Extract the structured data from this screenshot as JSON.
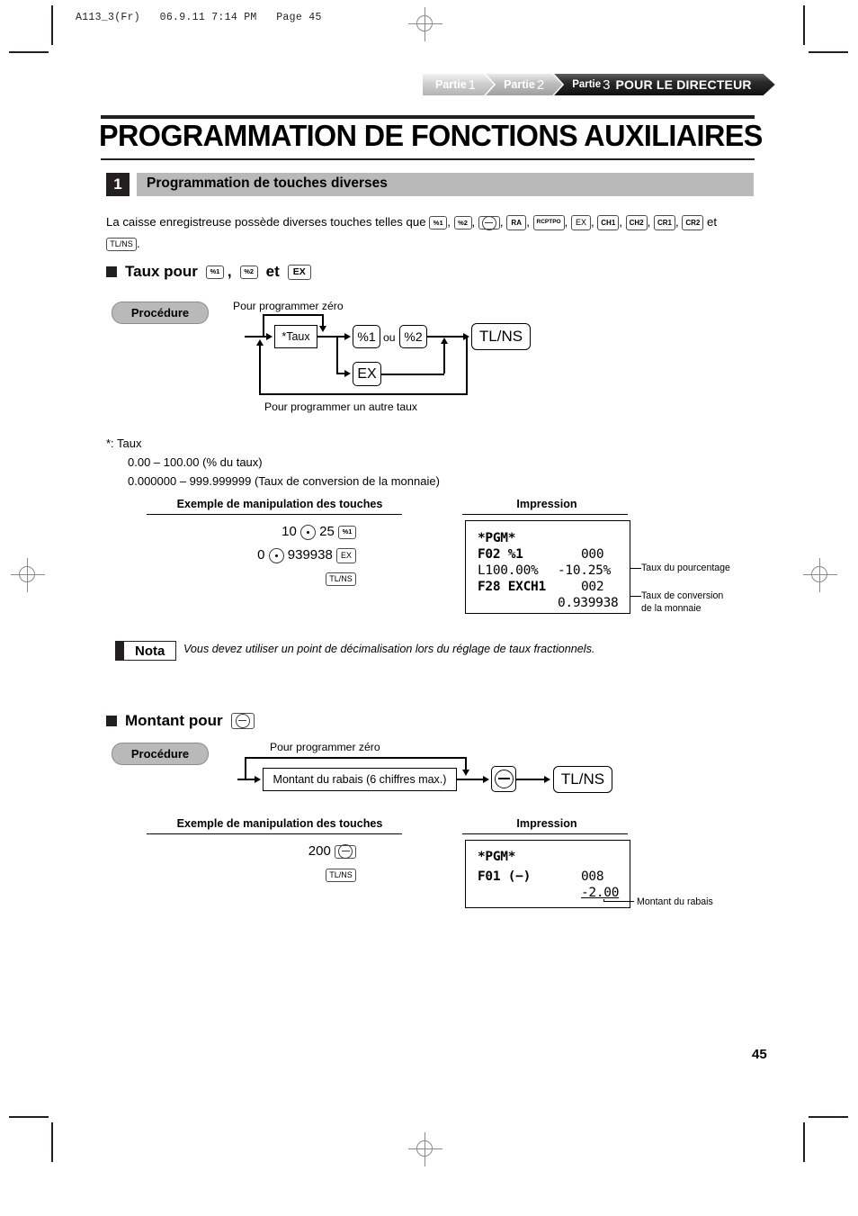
{
  "print_slug": "A113_3(Fr)   06.9.11 7:14 PM   Page 45",
  "tabs": {
    "part1_label": "Partie",
    "part1_num": "1",
    "part2_label": "Partie",
    "part2_num": "2",
    "part3_label": "Partie",
    "part3_num": "3",
    "part3_title": "POUR LE DIRECTEUR"
  },
  "chapter_title": "PROGRAMMATION DE FONCTIONS AUXILIAIRES",
  "section": {
    "number": "1",
    "title": "Programmation de touches diverses"
  },
  "intro": {
    "text_before": "La caisse enregistreuse possède diverses touches telles que",
    "keys": [
      "%1",
      "%2",
      "⊖",
      "RA",
      "RCPTPO",
      "EX",
      "CH1",
      "CH2",
      "CR1",
      "CR2"
    ],
    "text_and": "et",
    "last_key": "TL/NS",
    "period": "."
  },
  "rate_section": {
    "heading_text": "Taux pour",
    "heading_key1": "%1",
    "heading_comma": ",",
    "heading_key2": "%2",
    "heading_et": "et",
    "heading_key3": "EX",
    "procedure_label": "Procédure",
    "flow": {
      "top_label": "Pour programmer zéro",
      "bottom_label": "Pour programmer un autre taux",
      "entry_box": "*Taux",
      "key_pct1": "%1",
      "or_label": "ou",
      "key_pct2": "%2",
      "key_ex": "EX",
      "key_tlns": "TL/NS"
    },
    "footnote": {
      "line1": "*:  Taux",
      "line2": "0.00 – 100.00 (% du taux)",
      "line3": "0.000000 – 999.999999 (Taux de conversion de la monnaie)"
    },
    "example_head": "Exemple de manipulation des touches",
    "impression_head": "Impression",
    "keystrokes": [
      {
        "digits_a": "10",
        "dot": true,
        "digits_b": "25",
        "key": "%1"
      },
      {
        "digits_a": "0",
        "dot": true,
        "digits_b": "939938",
        "key": "EX"
      },
      {
        "digits_a": "",
        "dot": false,
        "digits_b": "",
        "key": "TL/NS"
      }
    ],
    "receipt_lines": [
      {
        "left": "*PGM*",
        "right": "",
        "bold": true
      },
      {
        "left": "F02 %1",
        "right": "000",
        "bold": false
      },
      {
        "left": "L100.00%",
        "right": "-10.25%",
        "bold": false
      },
      {
        "left": "F28 EXCH1",
        "right": "002",
        "bold": false
      },
      {
        "left": "",
        "right": "0.939938",
        "bold": false
      }
    ],
    "callout_1": "Taux du pourcentage",
    "callout_2": "Taux de conversion\nde la monnaie"
  },
  "nota": {
    "label": "Nota",
    "text": "Vous devez utiliser un point de décimalisation lors du réglage de taux fractionnels."
  },
  "amount_section": {
    "heading_text": "Montant pour",
    "heading_key": "⊖",
    "procedure_label": "Procédure",
    "flow": {
      "top_label": "Pour programmer zéro",
      "entry_box": "Montant du rabais (6 chiffres max.)",
      "key_minus": "⊖",
      "key_tlns": "TL/NS"
    },
    "example_head": "Exemple de manipulation des touches",
    "impression_head": "Impression",
    "keystrokes": [
      {
        "digits": "200",
        "key": "minus"
      },
      {
        "digits": "",
        "key": "TL/NS"
      }
    ],
    "receipt_lines": [
      {
        "left": "*PGM*",
        "right": "",
        "bold": true
      },
      {
        "left": "F01 (−)",
        "right": "008",
        "bold": false
      },
      {
        "left": "",
        "right": "-2.00",
        "bold": false,
        "underline": true
      }
    ],
    "callout_1": "Montant du rabais"
  },
  "page_number": "45",
  "colors": {
    "bar_gray": "#b9b9b9",
    "ink": "#231f20"
  }
}
